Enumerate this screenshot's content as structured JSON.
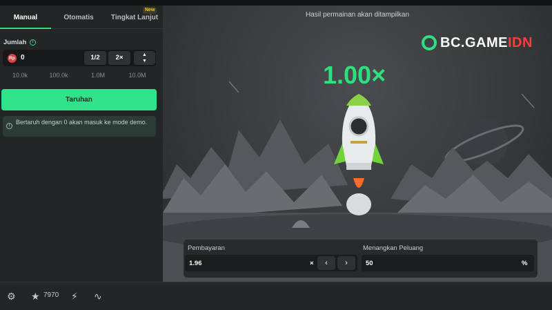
{
  "tabs": [
    {
      "label": "Manual"
    },
    {
      "label": "Otomatis"
    },
    {
      "label": "Tingkat Lanjut",
      "badge": "New"
    }
  ],
  "bet": {
    "amount_label": "Jumlah",
    "currency_icon_text": "Rp",
    "amount_value": "0",
    "half_label": "1/2",
    "double_label": "2×",
    "quick_amounts": [
      "10.0k",
      "100.0k",
      "1.0M",
      "10.0M"
    ],
    "bet_button_label": "Taruhan",
    "notice": "Bertaruh dengan 0 akan masuk ke mode demo."
  },
  "game": {
    "header": "Hasil permainan akan ditampilkan",
    "logo_main": "BC.GAME",
    "logo_suffix": "IDN",
    "multiplier": "1.00×",
    "payout_label": "Pembayaran",
    "payout_value": "1.96",
    "payout_suffix": "×",
    "win_chance_label": "Menangkan Peluang",
    "win_chance_value": "50",
    "win_chance_suffix": "%"
  },
  "bottom": {
    "star_count": "7970"
  },
  "colors": {
    "accent": "#2ee07d",
    "bet_button": "#2ee38a",
    "logo_red": "#ff3b3b"
  },
  "icons": [
    "info-icon",
    "chevron-up-icon",
    "chevron-down-icon",
    "settings-icon",
    "star-icon",
    "lightning-icon",
    "chart-icon",
    "chevron-left-icon",
    "chevron-right-icon",
    "rocket-icon",
    "planet-icon"
  ]
}
